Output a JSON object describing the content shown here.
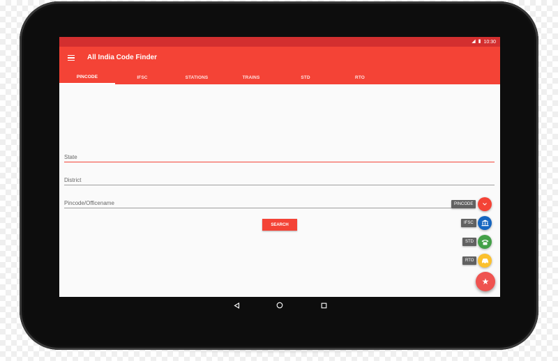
{
  "status_bar": {
    "time": "10:30"
  },
  "app": {
    "title": "All India Code Finder"
  },
  "tabs": [
    {
      "label": "PINCODE",
      "active": true
    },
    {
      "label": "IFSC",
      "active": false
    },
    {
      "label": "STATIONS",
      "active": false
    },
    {
      "label": "TRAINS",
      "active": false
    },
    {
      "label": "STD",
      "active": false
    },
    {
      "label": "RTO",
      "active": false
    }
  ],
  "form": {
    "state": {
      "placeholder": "State",
      "value": ""
    },
    "district": {
      "placeholder": "District",
      "value": ""
    },
    "pincode": {
      "placeholder": "Pincode/Officename",
      "value": ""
    },
    "search_label": "SEARCH"
  },
  "fab_menu": {
    "items": [
      {
        "label": "PINCODE",
        "icon": "chevron-down-icon",
        "color": "#f44336"
      },
      {
        "label": "IFSC",
        "icon": "bank-icon",
        "color": "#1565c0"
      },
      {
        "label": "STD",
        "icon": "phone-icon",
        "color": "#43a047"
      },
      {
        "label": "RTO",
        "icon": "car-icon",
        "color": "#fbc02d"
      }
    ],
    "main": {
      "icon": "star-icon",
      "color": "#ef5350"
    }
  },
  "colors": {
    "primary": "#f44336",
    "primary_dark": "#d32f2f"
  }
}
